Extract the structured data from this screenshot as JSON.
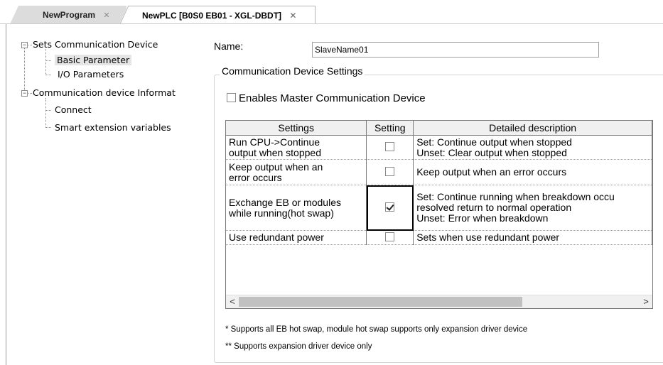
{
  "tabs": [
    {
      "label": "NewProgram",
      "close": "✕",
      "active": false
    },
    {
      "label": "NewPLC [B0S0 EB01 - XGL-DBDT]",
      "close": "✕",
      "active": true
    }
  ],
  "tree": {
    "root1": "Sets Communication Device",
    "root1_children": [
      "Basic Parameter",
      "I/O Parameters"
    ],
    "root2": "Communication device Informat",
    "root2_children": [
      "Connect",
      "Smart extension variables"
    ],
    "selected": "Basic Parameter"
  },
  "form": {
    "name_label": "Name:",
    "name_value": "SlaveName01",
    "group_title": "Communication Device Settings",
    "master_checkbox_label": "Enables Master Communication Device",
    "master_checked": false
  },
  "grid": {
    "headers": [
      "Settings",
      "Setting",
      "Detailed description"
    ],
    "rows": [
      {
        "setting": [
          "Run CPU->Continue",
          "output when stopped"
        ],
        "checked": false,
        "description": [
          "Set: Continue output when stopped",
          "Unset: Clear output when stopped"
        ]
      },
      {
        "setting": [
          "Keep output when an",
          "error occurs"
        ],
        "checked": false,
        "description": [
          "Keep output when an error occurs"
        ]
      },
      {
        "setting": [
          "Exchange EB or modules",
          "while running(hot swap)"
        ],
        "checked": true,
        "description": [
          "Set: Continue running when breakdown occu",
          "resolved return to normal operation",
          "Unset: Error when breakdown"
        ]
      },
      {
        "setting": [
          "Use redundant power"
        ],
        "checked": false,
        "description": [
          "Sets when use redundant power"
        ]
      }
    ],
    "scroll_left": "<",
    "scroll_right": ">"
  },
  "notes": [
    "* Supports all EB hot swap, module hot swap supports only expansion driver device",
    "** Supports expansion driver device only"
  ]
}
